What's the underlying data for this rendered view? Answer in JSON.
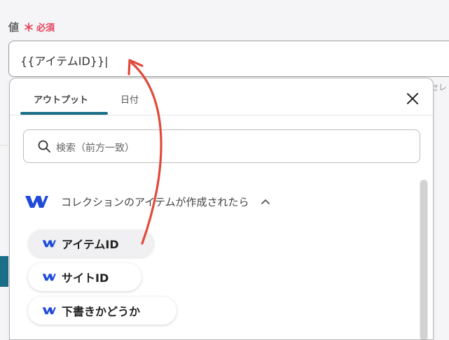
{
  "field": {
    "label": "値",
    "required_star": "＊",
    "required_text": "必須",
    "value": "{{アイテムID}}|"
  },
  "side_text": "セレ",
  "dropdown": {
    "tabs": [
      {
        "label": "アウトプット",
        "active": true
      },
      {
        "label": "日付",
        "active": false
      }
    ],
    "search_placeholder": "検索（前方一致）",
    "group_title": "コレクションのアイテムが作成されたら",
    "items": [
      {
        "label": "アイテムID"
      },
      {
        "label": "サイトID"
      },
      {
        "label": "下書きかどうか"
      }
    ]
  },
  "colors": {
    "accent": "#1b6f89",
    "required": "#e8415a",
    "annotation_arrow": "#e04a3a",
    "webflow": "#1f4bd8"
  },
  "icons": {
    "close": "close-icon",
    "search": "search-icon",
    "logo": "webflow-logo-icon",
    "collapse": "chevron-up-icon"
  }
}
